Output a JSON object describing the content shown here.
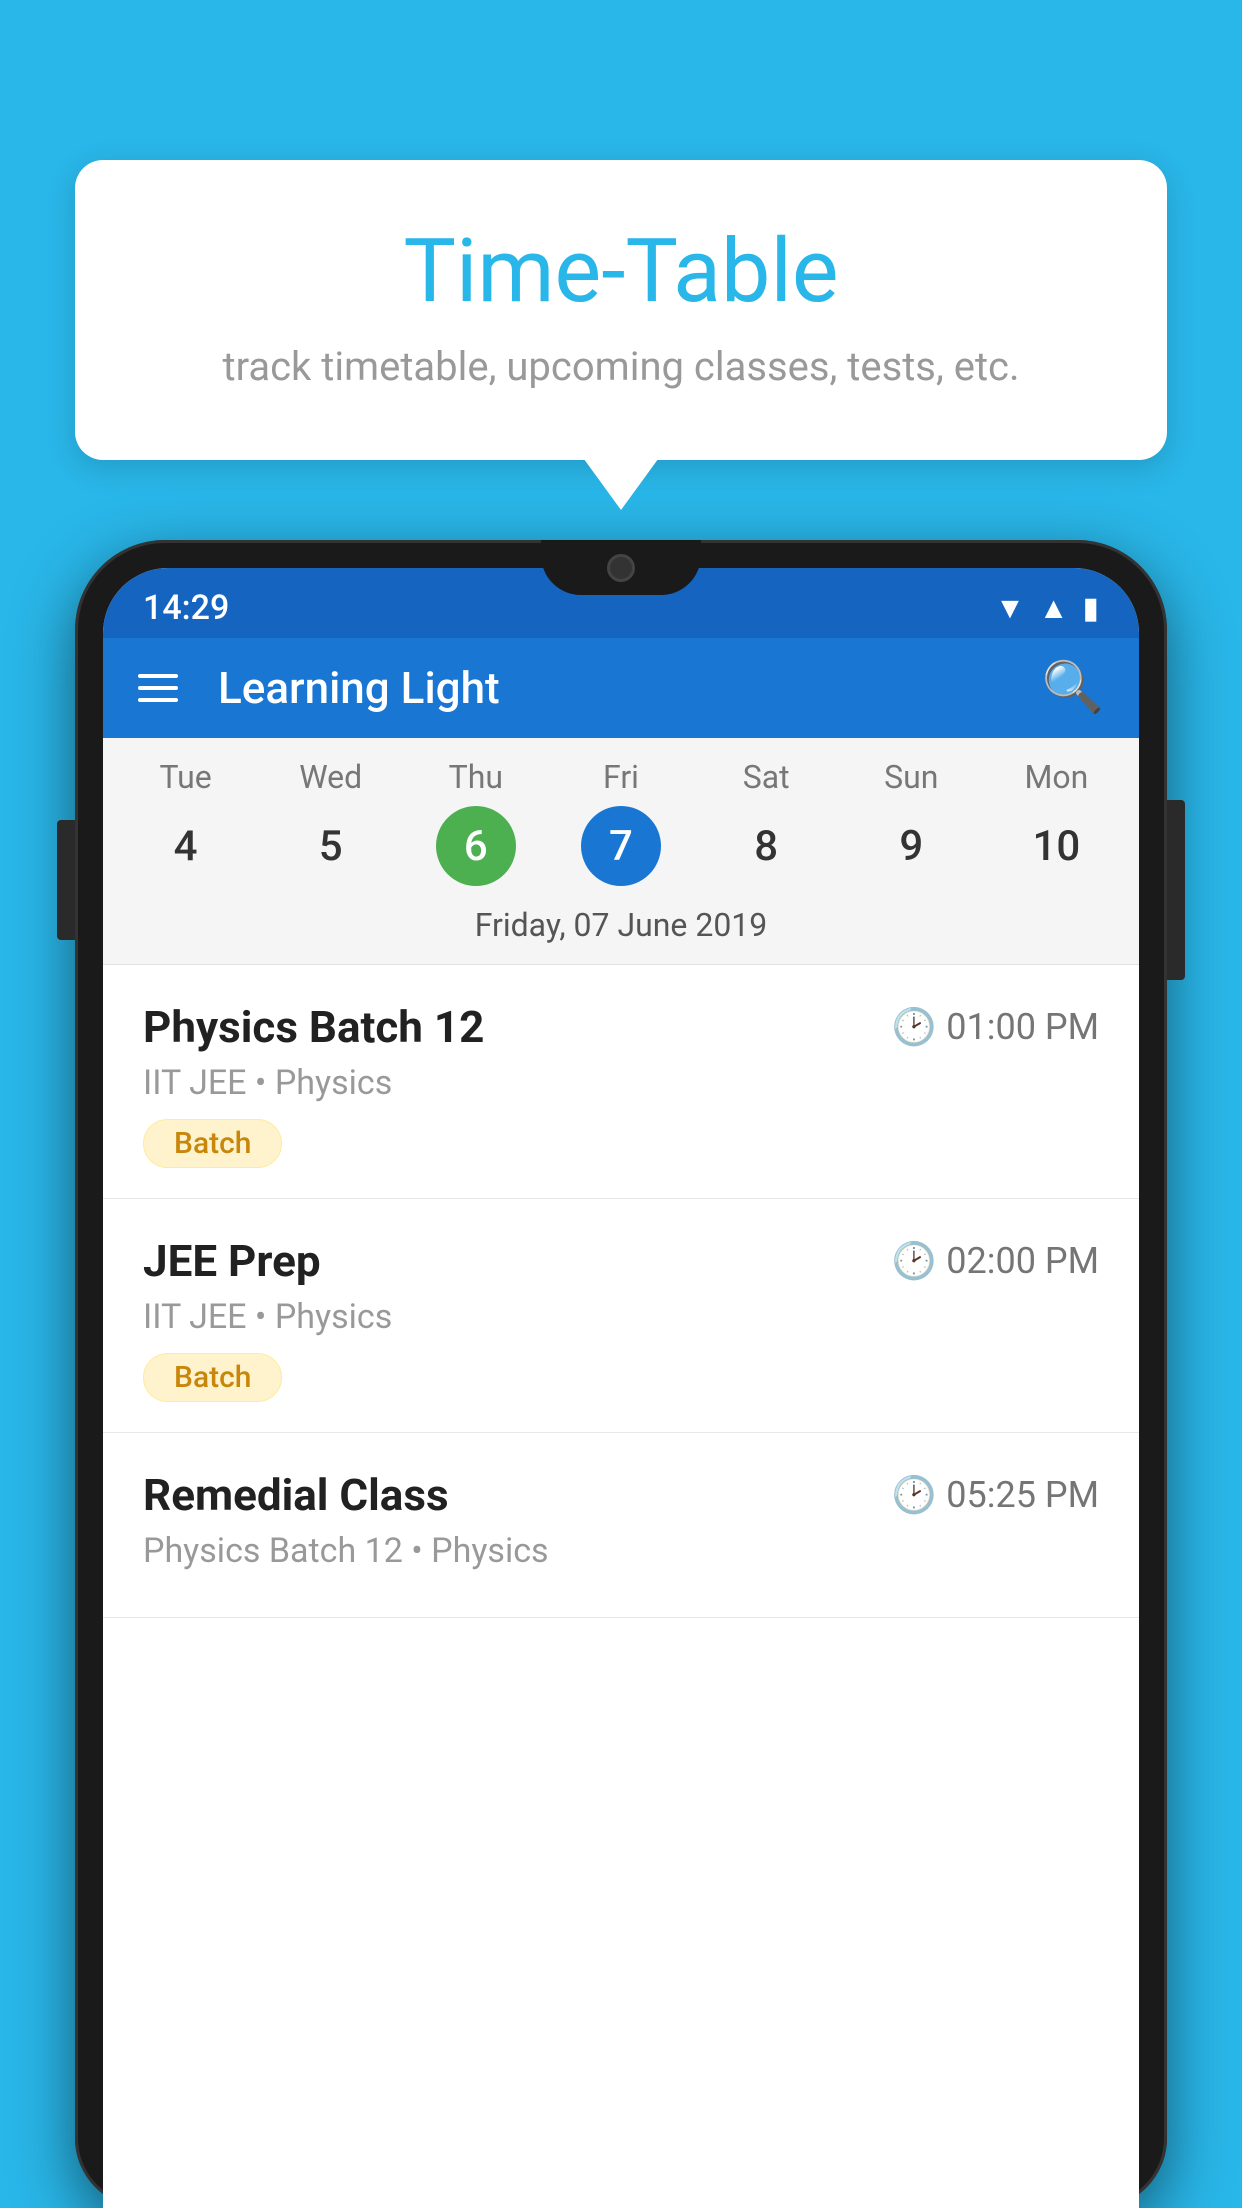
{
  "background": {
    "color": "#29B6E8"
  },
  "tooltip": {
    "title": "Time-Table",
    "subtitle": "track timetable, upcoming classes, tests, etc."
  },
  "phone": {
    "status_bar": {
      "time": "14:29"
    },
    "app_bar": {
      "title": "Learning Light",
      "menu_icon": "menu-icon",
      "search_icon": "search-icon"
    },
    "calendar": {
      "days": [
        {
          "name": "Tue",
          "number": "4",
          "state": "normal"
        },
        {
          "name": "Wed",
          "number": "5",
          "state": "normal"
        },
        {
          "name": "Thu",
          "number": "6",
          "state": "today"
        },
        {
          "name": "Fri",
          "number": "7",
          "state": "selected"
        },
        {
          "name": "Sat",
          "number": "8",
          "state": "normal"
        },
        {
          "name": "Sun",
          "number": "9",
          "state": "normal"
        },
        {
          "name": "Mon",
          "number": "10",
          "state": "normal"
        }
      ],
      "selected_date_label": "Friday, 07 June 2019"
    },
    "schedule": {
      "items": [
        {
          "title": "Physics Batch 12",
          "time": "01:00 PM",
          "subtitle": "IIT JEE • Physics",
          "badge": "Batch"
        },
        {
          "title": "JEE Prep",
          "time": "02:00 PM",
          "subtitle": "IIT JEE • Physics",
          "badge": "Batch"
        },
        {
          "title": "Remedial Class",
          "time": "05:25 PM",
          "subtitle": "Physics Batch 12 • Physics",
          "badge": null
        }
      ]
    }
  }
}
